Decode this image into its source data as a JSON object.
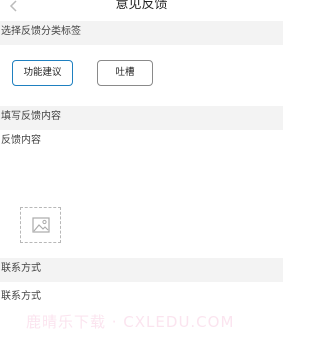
{
  "header": {
    "title": "意见反馈",
    "back_icon": "chevron-left-icon"
  },
  "category_section": {
    "title": "选择反馈分类标签",
    "tags": [
      {
        "label": "功能建议",
        "selected": true
      },
      {
        "label": "吐槽",
        "selected": false
      }
    ]
  },
  "content_section": {
    "title": "填写反馈内容",
    "placeholder": "反馈内容",
    "add_image_icon": "image-icon"
  },
  "contact_section": {
    "title": "联系方式",
    "placeholder": "联系方式"
  },
  "watermark": {
    "text": "鹿晴乐下载 · CXLEDU.COM"
  },
  "colors": {
    "accent": "#1f80c0",
    "section_bg": "#f3f3f3",
    "watermark": "#eb82b4"
  }
}
